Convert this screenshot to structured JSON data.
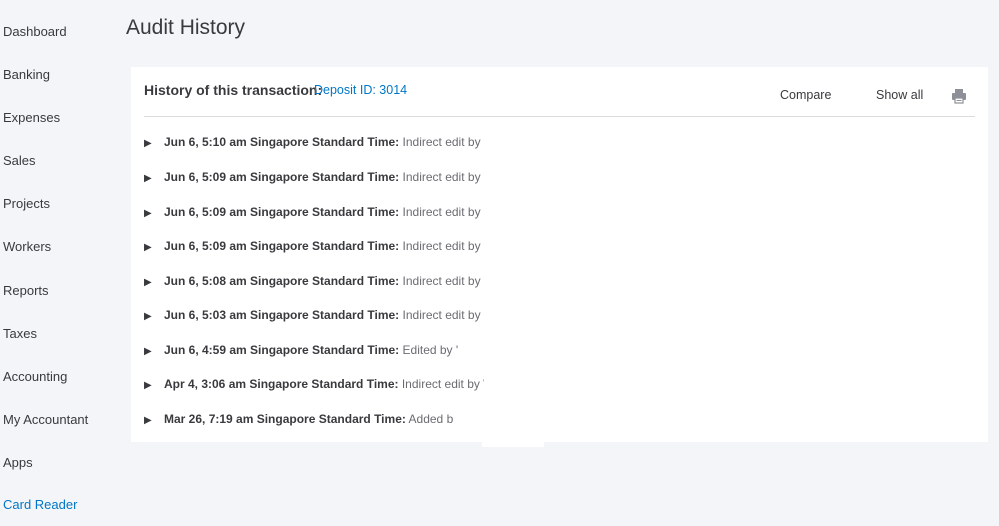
{
  "sidebar": {
    "items": [
      {
        "label": "Dashboard"
      },
      {
        "label": "Banking"
      },
      {
        "label": "Expenses"
      },
      {
        "label": "Sales"
      },
      {
        "label": "Projects"
      },
      {
        "label": "Workers"
      },
      {
        "label": "Reports"
      },
      {
        "label": "Taxes"
      },
      {
        "label": "Accounting"
      },
      {
        "label": "My Accountant"
      },
      {
        "label": "Apps"
      },
      {
        "label": "Card Reader"
      }
    ],
    "active_color": "#0077c5"
  },
  "page": {
    "title": "Audit History"
  },
  "panel": {
    "history_label": "History of this transaction:",
    "deposit_link": "Deposit ID: 3014",
    "compare_label": "Compare",
    "show_all_label": "Show all",
    "print_icon": "printer-icon",
    "expand_icon": "▶",
    "rows": [
      {
        "timestamp": "Jun 6, 5:10 am Singapore Standard Time:",
        "description": " Indirect edit by \\"
      },
      {
        "timestamp": "Jun 6, 5:09 am Singapore Standard Time:",
        "description": " Indirect edit by \\"
      },
      {
        "timestamp": "Jun 6, 5:09 am Singapore Standard Time:",
        "description": " Indirect edit by \\"
      },
      {
        "timestamp": "Jun 6, 5:09 am Singapore Standard Time:",
        "description": " Indirect edit by \\"
      },
      {
        "timestamp": "Jun 6, 5:08 am Singapore Standard Time:",
        "description": " Indirect edit by \\"
      },
      {
        "timestamp": "Jun 6, 5:03 am Singapore Standard Time:",
        "description": " Indirect edit by \\"
      },
      {
        "timestamp": "Jun 6, 4:59 am Singapore Standard Time:",
        "description": " Edited by '"
      },
      {
        "timestamp": "Apr 4, 3:06 am Singapore Standard Time:",
        "description": " Indirect edit by \\"
      },
      {
        "timestamp": "Mar 26, 7:19 am Singapore Standard Time:",
        "description": " Added b"
      }
    ]
  }
}
